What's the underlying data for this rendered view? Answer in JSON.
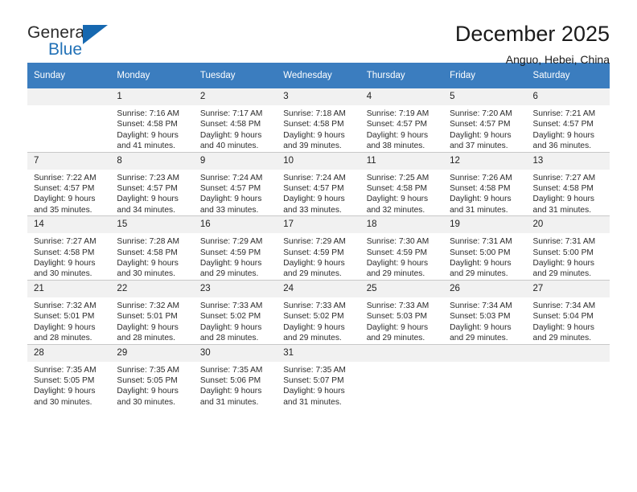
{
  "brand": {
    "line1": "General",
    "line2": "Blue",
    "triangle_color": "#1668b0"
  },
  "header": {
    "title": "December 2025",
    "subtitle": "Anguo, Hebei, China"
  },
  "theme": {
    "header_row_bg": "#3b7dbf",
    "daynum_bg": "#f1f1f1",
    "grid_line": "#c8c8c8",
    "text": "#2b2b2b"
  },
  "weekdays": [
    "Sunday",
    "Monday",
    "Tuesday",
    "Wednesday",
    "Thursday",
    "Friday",
    "Saturday"
  ],
  "weeks": [
    [
      {
        "day": "",
        "lines": []
      },
      {
        "day": "1",
        "lines": [
          "Sunrise: 7:16 AM",
          "Sunset: 4:58 PM",
          "Daylight: 9 hours",
          "and 41 minutes."
        ]
      },
      {
        "day": "2",
        "lines": [
          "Sunrise: 7:17 AM",
          "Sunset: 4:58 PM",
          "Daylight: 9 hours",
          "and 40 minutes."
        ]
      },
      {
        "day": "3",
        "lines": [
          "Sunrise: 7:18 AM",
          "Sunset: 4:58 PM",
          "Daylight: 9 hours",
          "and 39 minutes."
        ]
      },
      {
        "day": "4",
        "lines": [
          "Sunrise: 7:19 AM",
          "Sunset: 4:57 PM",
          "Daylight: 9 hours",
          "and 38 minutes."
        ]
      },
      {
        "day": "5",
        "lines": [
          "Sunrise: 7:20 AM",
          "Sunset: 4:57 PM",
          "Daylight: 9 hours",
          "and 37 minutes."
        ]
      },
      {
        "day": "6",
        "lines": [
          "Sunrise: 7:21 AM",
          "Sunset: 4:57 PM",
          "Daylight: 9 hours",
          "and 36 minutes."
        ]
      }
    ],
    [
      {
        "day": "7",
        "lines": [
          "Sunrise: 7:22 AM",
          "Sunset: 4:57 PM",
          "Daylight: 9 hours",
          "and 35 minutes."
        ]
      },
      {
        "day": "8",
        "lines": [
          "Sunrise: 7:23 AM",
          "Sunset: 4:57 PM",
          "Daylight: 9 hours",
          "and 34 minutes."
        ]
      },
      {
        "day": "9",
        "lines": [
          "Sunrise: 7:24 AM",
          "Sunset: 4:57 PM",
          "Daylight: 9 hours",
          "and 33 minutes."
        ]
      },
      {
        "day": "10",
        "lines": [
          "Sunrise: 7:24 AM",
          "Sunset: 4:57 PM",
          "Daylight: 9 hours",
          "and 33 minutes."
        ]
      },
      {
        "day": "11",
        "lines": [
          "Sunrise: 7:25 AM",
          "Sunset: 4:58 PM",
          "Daylight: 9 hours",
          "and 32 minutes."
        ]
      },
      {
        "day": "12",
        "lines": [
          "Sunrise: 7:26 AM",
          "Sunset: 4:58 PM",
          "Daylight: 9 hours",
          "and 31 minutes."
        ]
      },
      {
        "day": "13",
        "lines": [
          "Sunrise: 7:27 AM",
          "Sunset: 4:58 PM",
          "Daylight: 9 hours",
          "and 31 minutes."
        ]
      }
    ],
    [
      {
        "day": "14",
        "lines": [
          "Sunrise: 7:27 AM",
          "Sunset: 4:58 PM",
          "Daylight: 9 hours",
          "and 30 minutes."
        ]
      },
      {
        "day": "15",
        "lines": [
          "Sunrise: 7:28 AM",
          "Sunset: 4:58 PM",
          "Daylight: 9 hours",
          "and 30 minutes."
        ]
      },
      {
        "day": "16",
        "lines": [
          "Sunrise: 7:29 AM",
          "Sunset: 4:59 PM",
          "Daylight: 9 hours",
          "and 29 minutes."
        ]
      },
      {
        "day": "17",
        "lines": [
          "Sunrise: 7:29 AM",
          "Sunset: 4:59 PM",
          "Daylight: 9 hours",
          "and 29 minutes."
        ]
      },
      {
        "day": "18",
        "lines": [
          "Sunrise: 7:30 AM",
          "Sunset: 4:59 PM",
          "Daylight: 9 hours",
          "and 29 minutes."
        ]
      },
      {
        "day": "19",
        "lines": [
          "Sunrise: 7:31 AM",
          "Sunset: 5:00 PM",
          "Daylight: 9 hours",
          "and 29 minutes."
        ]
      },
      {
        "day": "20",
        "lines": [
          "Sunrise: 7:31 AM",
          "Sunset: 5:00 PM",
          "Daylight: 9 hours",
          "and 29 minutes."
        ]
      }
    ],
    [
      {
        "day": "21",
        "lines": [
          "Sunrise: 7:32 AM",
          "Sunset: 5:01 PM",
          "Daylight: 9 hours",
          "and 28 minutes."
        ]
      },
      {
        "day": "22",
        "lines": [
          "Sunrise: 7:32 AM",
          "Sunset: 5:01 PM",
          "Daylight: 9 hours",
          "and 28 minutes."
        ]
      },
      {
        "day": "23",
        "lines": [
          "Sunrise: 7:33 AM",
          "Sunset: 5:02 PM",
          "Daylight: 9 hours",
          "and 28 minutes."
        ]
      },
      {
        "day": "24",
        "lines": [
          "Sunrise: 7:33 AM",
          "Sunset: 5:02 PM",
          "Daylight: 9 hours",
          "and 29 minutes."
        ]
      },
      {
        "day": "25",
        "lines": [
          "Sunrise: 7:33 AM",
          "Sunset: 5:03 PM",
          "Daylight: 9 hours",
          "and 29 minutes."
        ]
      },
      {
        "day": "26",
        "lines": [
          "Sunrise: 7:34 AM",
          "Sunset: 5:03 PM",
          "Daylight: 9 hours",
          "and 29 minutes."
        ]
      },
      {
        "day": "27",
        "lines": [
          "Sunrise: 7:34 AM",
          "Sunset: 5:04 PM",
          "Daylight: 9 hours",
          "and 29 minutes."
        ]
      }
    ],
    [
      {
        "day": "28",
        "lines": [
          "Sunrise: 7:35 AM",
          "Sunset: 5:05 PM",
          "Daylight: 9 hours",
          "and 30 minutes."
        ]
      },
      {
        "day": "29",
        "lines": [
          "Sunrise: 7:35 AM",
          "Sunset: 5:05 PM",
          "Daylight: 9 hours",
          "and 30 minutes."
        ]
      },
      {
        "day": "30",
        "lines": [
          "Sunrise: 7:35 AM",
          "Sunset: 5:06 PM",
          "Daylight: 9 hours",
          "and 31 minutes."
        ]
      },
      {
        "day": "31",
        "lines": [
          "Sunrise: 7:35 AM",
          "Sunset: 5:07 PM",
          "Daylight: 9 hours",
          "and 31 minutes."
        ]
      },
      {
        "day": "",
        "lines": []
      },
      {
        "day": "",
        "lines": []
      },
      {
        "day": "",
        "lines": []
      }
    ]
  ]
}
